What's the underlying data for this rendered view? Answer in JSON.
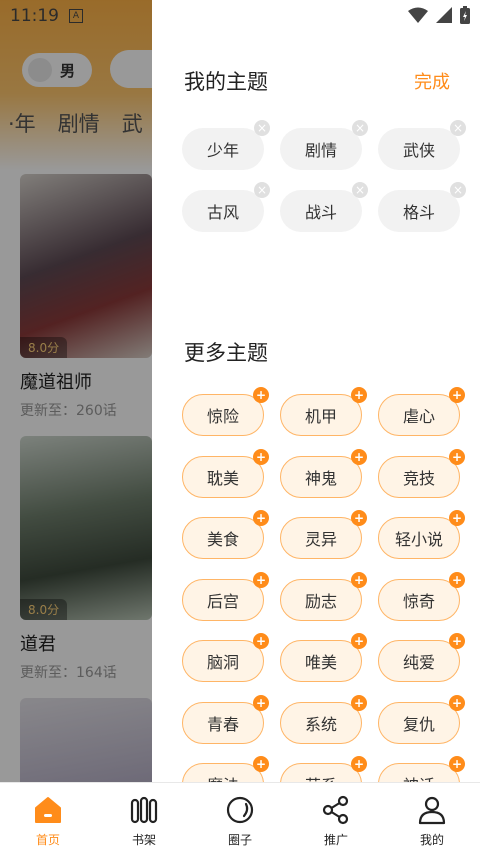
{
  "status_bar": {
    "time": "11:19",
    "a_icon": "A"
  },
  "background": {
    "gender_label": "男",
    "tabs": [
      "·年",
      "剧情",
      "武"
    ],
    "books": [
      {
        "score": "8.0分",
        "title": "魔道祖师",
        "update": "更新至：260话"
      },
      {
        "score": "8.0分",
        "title": "道君",
        "update": "更新至：164话"
      }
    ]
  },
  "drawer": {
    "my_title": "我的主题",
    "done_label": "完成",
    "my_topics": [
      "少年",
      "剧情",
      "武侠",
      "古风",
      "战斗",
      "格斗"
    ],
    "remove_symbol": "×",
    "more_title": "更多主题",
    "add_symbol": "+",
    "more_topics": [
      "惊险",
      "机甲",
      "虐心",
      "耽美",
      "神鬼",
      "竞技",
      "美食",
      "灵异",
      "轻小说",
      "后宫",
      "励志",
      "惊奇",
      "脑洞",
      "唯美",
      "纯爱",
      "青春",
      "系统",
      "复仇",
      "魔法",
      "萌系",
      "神话"
    ]
  },
  "bottom_nav": [
    {
      "label": "首页",
      "icon": "home-icon",
      "active": true
    },
    {
      "label": "书架",
      "icon": "bookshelf-icon",
      "active": false
    },
    {
      "label": "圈子",
      "icon": "circle-icon",
      "active": false
    },
    {
      "label": "推广",
      "icon": "share-icon",
      "active": false
    },
    {
      "label": "我的",
      "icon": "profile-icon",
      "active": false
    }
  ],
  "colors": {
    "accent": "#ff8c1a",
    "chip_more_bg": "#fff4e6",
    "chip_mine_bg": "#f2f2f2"
  }
}
